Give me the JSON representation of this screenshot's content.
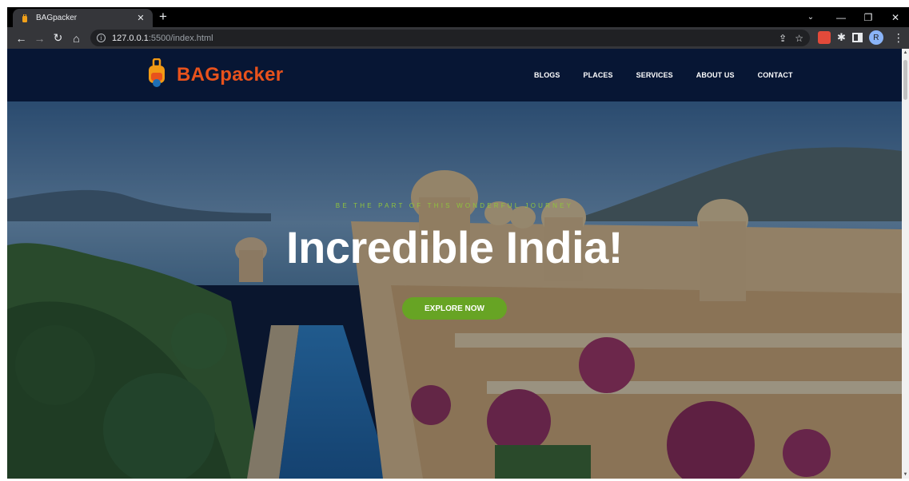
{
  "browser": {
    "tab": {
      "title": "BAGpacker"
    },
    "address": {
      "host": "127.0.0.1",
      "path": ":5500/index.html"
    },
    "avatar_letter": "R",
    "icons": {
      "back": "arrow-left-icon",
      "forward": "arrow-right-icon",
      "reload": "reload-icon",
      "home": "home-icon",
      "share": "share-icon",
      "bookmark": "star-icon",
      "extensions": "puzzle-icon",
      "side_panel": "side-panel-icon",
      "menu": "more-vert-icon"
    }
  },
  "site": {
    "brand": "BAGpacker",
    "brand_color": "#e8521c",
    "nav": [
      "BLOGS",
      "PLACES",
      "SERVICES",
      "ABOUT US",
      "CONTACT"
    ],
    "hero": {
      "tagline": "BE THE PART OF THIS WONDERFUL JOURNEY",
      "title": "Incredible India!",
      "cta_label": "EXPLORE NOW",
      "cta_color": "#67a424"
    }
  }
}
